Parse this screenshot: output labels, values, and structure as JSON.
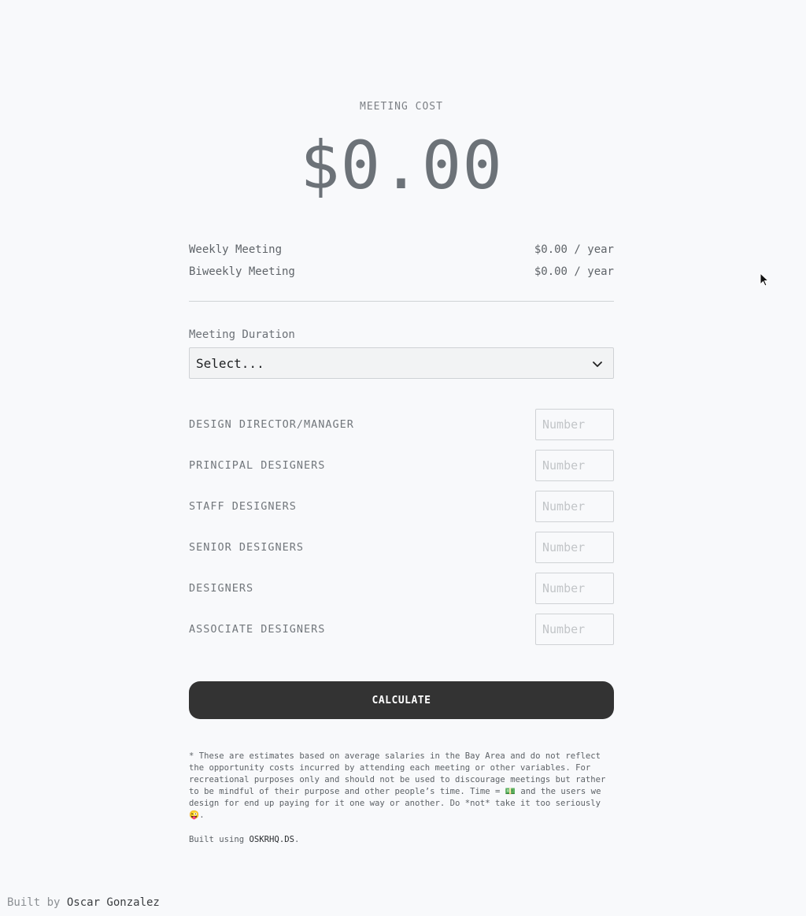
{
  "header": {
    "label": "MEETING COST",
    "total": "$0.00"
  },
  "summary": [
    {
      "label": "Weekly Meeting",
      "value": "$0.00 / year"
    },
    {
      "label": "Biweekly Meeting",
      "value": "$0.00 / year"
    }
  ],
  "duration": {
    "label": "Meeting Duration",
    "selected": "Select..."
  },
  "roles": [
    {
      "label": "DESIGN DIRECTOR/MANAGER",
      "placeholder": "Number"
    },
    {
      "label": "PRINCIPAL DESIGNERS",
      "placeholder": "Number"
    },
    {
      "label": "STAFF DESIGNERS",
      "placeholder": "Number"
    },
    {
      "label": "SENIOR DESIGNERS",
      "placeholder": "Number"
    },
    {
      "label": "DESIGNERS",
      "placeholder": "Number"
    },
    {
      "label": "ASSOCIATE DESIGNERS",
      "placeholder": "Number"
    }
  ],
  "calculate_label": "CALCULATE",
  "disclaimer": {
    "part1": "* These are estimates based on average salaries in the Bay Area and do not reflect the opportunity costs incurred by attending each meeting or other variables. For recreational purposes only and should not be used to discourage meetings but rather to be mindful of their purpose and other people’s time. Time = ",
    "money_emoji": "💵",
    "part2": " and the users we design for end up paying for it one way or another. Do *not* take it too seriously ",
    "wink_emoji": "😜",
    "part3": "."
  },
  "built_using": {
    "prefix": "Built using ",
    "link": "OSKRHQ.DS",
    "suffix": "."
  },
  "footer": {
    "prefix": "Built by ",
    "link": "Oscar Gonzalez"
  },
  "icons": {
    "select_chevron": "chevron-down-icon",
    "cursor": "mouse-pointer-icon"
  }
}
